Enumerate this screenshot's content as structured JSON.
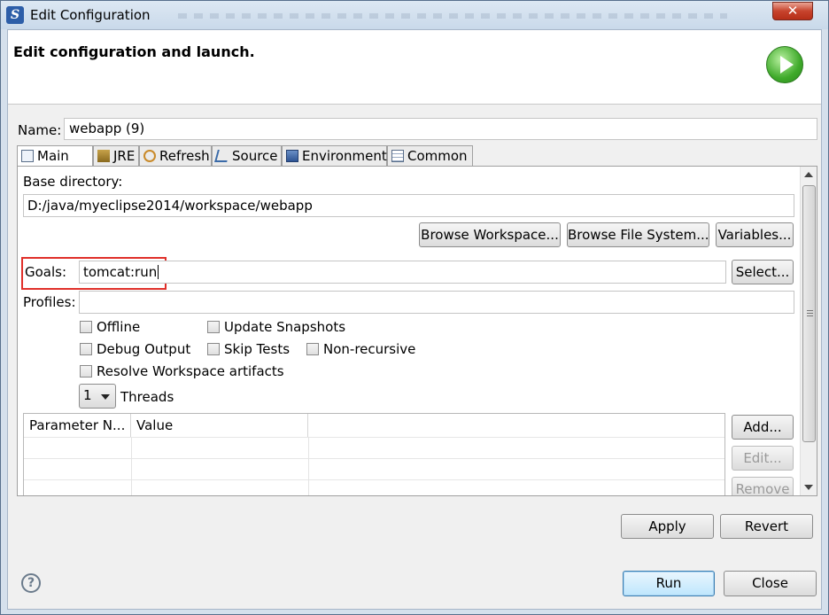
{
  "window": {
    "title": "Edit Configuration",
    "close_glyph": "✕",
    "app_icon_letter": "S"
  },
  "header": {
    "title": "Edit configuration and launch."
  },
  "name": {
    "label": "Name:",
    "value": "webapp (9)"
  },
  "tabs": [
    {
      "label": "Main",
      "icon": "main-tab-icon",
      "active": true
    },
    {
      "label": "JRE",
      "icon": "jre-icon"
    },
    {
      "label": "Refresh",
      "icon": "refresh-icon"
    },
    {
      "label": "Source",
      "icon": "source-icon"
    },
    {
      "label": "Environment",
      "icon": "environment-icon"
    },
    {
      "label": "Common",
      "icon": "common-icon"
    }
  ],
  "main": {
    "base_directory_label": "Base directory:",
    "base_directory_value": "D:/java/myeclipse2014/workspace/webapp",
    "browse_workspace": "Browse Workspace...",
    "browse_file_system": "Browse File System...",
    "variables": "Variables...",
    "goals_label": "Goals:",
    "goals_value": "tomcat:run",
    "goals_select": "Select...",
    "profiles_label": "Profiles:",
    "profiles_value": "",
    "checkboxes": {
      "offline": "Offline",
      "update_snapshots": "Update Snapshots",
      "debug_output": "Debug Output",
      "skip_tests": "Skip Tests",
      "non_recursive": "Non-recursive",
      "resolve_workspace": "Resolve Workspace artifacts"
    },
    "threads_value": "1",
    "threads_label": "Threads",
    "params_table": {
      "columns": [
        "Parameter N...",
        "Value",
        ""
      ]
    },
    "param_buttons": {
      "add": "Add...",
      "edit": "Edit...",
      "remove": "Remove"
    }
  },
  "footer": {
    "apply": "Apply",
    "revert": "Revert",
    "run": "Run",
    "close": "Close",
    "help_glyph": "?"
  },
  "colors": {
    "highlight": "#e0302a",
    "run_icon": "#3faa2a",
    "close_button": "#c7432d"
  }
}
